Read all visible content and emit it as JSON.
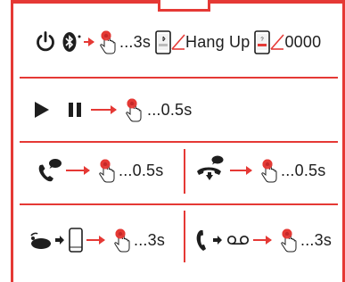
{
  "colors": {
    "accent": "#e53935",
    "text": "#1e1e1e"
  },
  "rows": {
    "power": {
      "icons": [
        "power-icon",
        "bluetooth-icon",
        "press-button-icon",
        "phone-hangup-screen-icon",
        "phone-dial-screen-icon"
      ],
      "duration": "...3s",
      "result_label": "Hang Up",
      "redial_number": "0000"
    },
    "play_pause": {
      "icons": [
        "play-icon",
        "pause-icon",
        "press-button-icon"
      ],
      "duration": "...0.5s"
    },
    "answer_call": {
      "icons": [
        "incoming-call-icon",
        "press-button-icon"
      ],
      "duration": "...0.5s"
    },
    "end_call": {
      "icons": [
        "hang-up-call-icon",
        "press-button-icon"
      ],
      "duration": "...0.5s"
    },
    "transfer_call": {
      "icons": [
        "headset-icon",
        "phone-icon",
        "press-button-icon"
      ],
      "duration": "...3s"
    },
    "voicemail": {
      "icons": [
        "call-icon",
        "voicemail-icon",
        "press-button-icon"
      ],
      "duration": "...3s"
    }
  }
}
